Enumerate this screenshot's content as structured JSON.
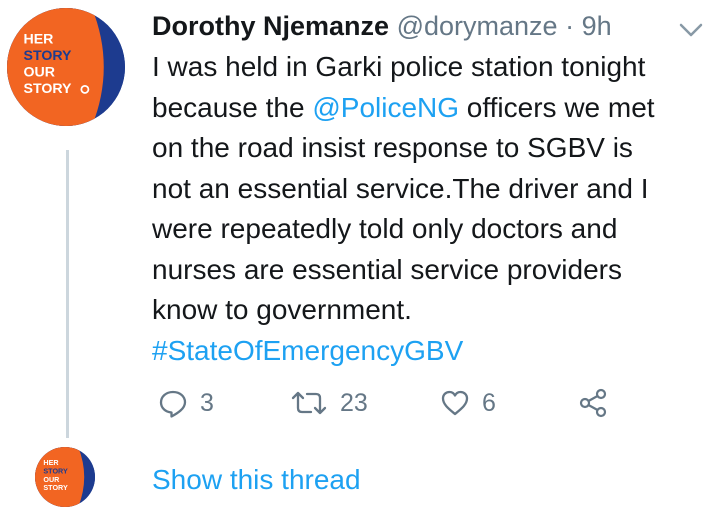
{
  "tweet": {
    "author_name": "Dorothy Njemanze",
    "handle": "@dorymanze",
    "separator": "·",
    "time": "9h",
    "avatar_text": [
      "HER",
      "STORY",
      "OUR",
      "STORY"
    ],
    "text": {
      "lines": [
        "I was held in Garki police station tonight",
        "because the ",
        "@PoliceNG",
        " officers we met",
        "on the road insist response to SGBV is",
        "not an essential service.The driver and I",
        "were repeatedly told only doctors and",
        "nurses are essential service providers",
        "know to government.",
        "#StateOfEmergencyGBV"
      ]
    },
    "actions": {
      "reply_count": "3",
      "retweet_count": "23",
      "like_count": "6"
    },
    "show_thread_label": "Show this thread"
  },
  "colors": {
    "link": "#1da1f2",
    "secondary_text": "#657786",
    "avatar_orange": "#f26522",
    "avatar_navy": "#1d3b8f",
    "thread_line": "#ccd6dd"
  },
  "icons": [
    "caret-down-icon",
    "reply-icon",
    "retweet-icon",
    "like-icon",
    "share-icon"
  ]
}
